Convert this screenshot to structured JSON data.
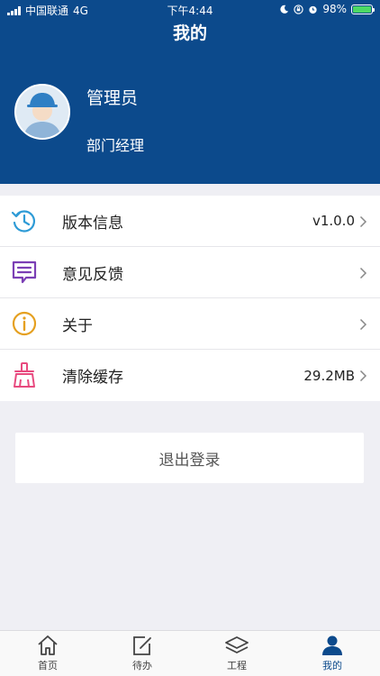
{
  "status_bar": {
    "carrier": "中国联通",
    "network": "4G",
    "time": "下午4:44",
    "battery": "98%",
    "battery_level": 0.98
  },
  "header": {
    "title": "我的",
    "background_color": "#0c4a8c"
  },
  "user": {
    "name": "管理员",
    "role": "部门经理"
  },
  "menu": {
    "items": [
      {
        "label": "版本信息",
        "value": "v1.0.0",
        "icon": "history-clock-icon",
        "color": "#2e9bd6"
      },
      {
        "label": "意见反馈",
        "value": "",
        "icon": "feedback-message-icon",
        "color": "#7b3fb5"
      },
      {
        "label": "关于",
        "value": "",
        "icon": "info-circle-icon",
        "color": "#e5a020"
      },
      {
        "label": "清除缓存",
        "value": "29.2MB",
        "icon": "broom-icon",
        "color": "#e84a7f"
      }
    ]
  },
  "logout": {
    "label": "退出登录"
  },
  "tabbar": {
    "items": [
      {
        "label": "首页",
        "icon": "home-icon"
      },
      {
        "label": "待办",
        "icon": "edit-icon"
      },
      {
        "label": "工程",
        "icon": "layers-icon"
      },
      {
        "label": "我的",
        "icon": "user-icon",
        "active": true
      }
    ],
    "active_color": "#0c4a8c"
  }
}
